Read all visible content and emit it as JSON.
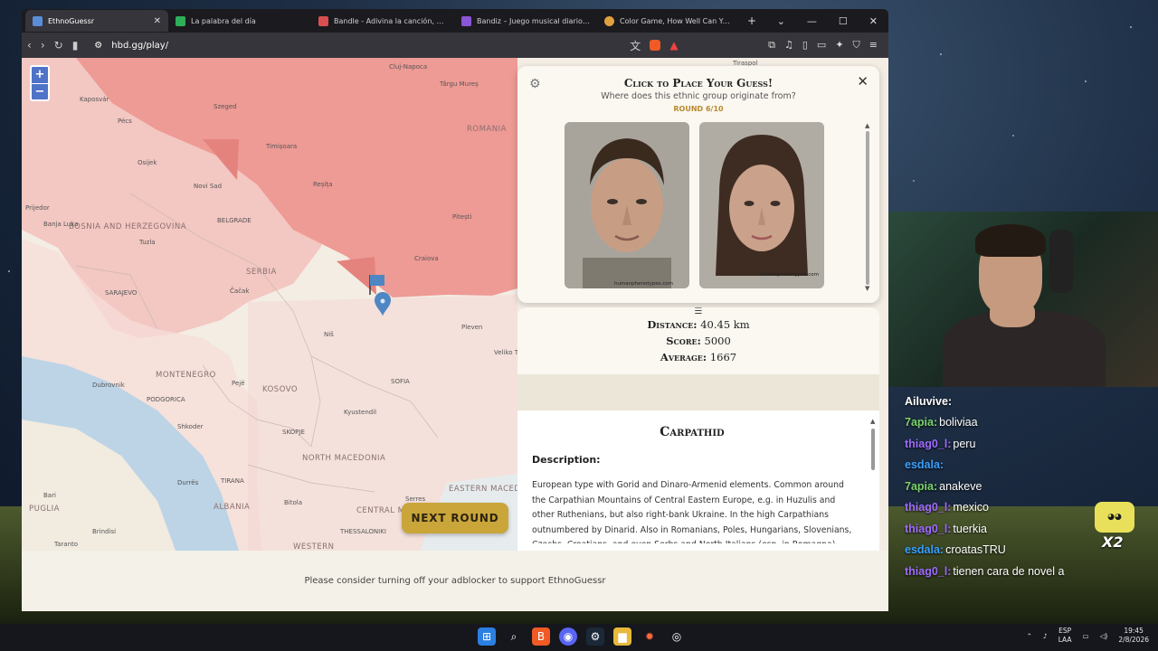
{
  "browser": {
    "tabs": [
      {
        "label": "EthnoGuessr",
        "active": true,
        "color": "#5a8dd6"
      },
      {
        "label": "La palabra del día",
        "active": false,
        "color": "#2fae5a"
      },
      {
        "label": "Bandle - Adivina la canción, un instr",
        "active": false,
        "color": "#d94f4f"
      },
      {
        "label": "Bandiz – Juego musical diario, pista",
        "active": false,
        "color": "#8a55d8"
      },
      {
        "label": "Color Game, How Well Can You Rem",
        "active": false,
        "color": "#e0a040"
      }
    ],
    "new_tab": "+",
    "url": "hbd.gg/play/"
  },
  "map": {
    "zoom_in": "+",
    "zoom_out": "−",
    "countries": {
      "romania": "ROMANIA",
      "bosnia": "BOSNIA AND HERZEGOVINA",
      "serbia": "SERBIA",
      "montenegro": "MONTENEGRO",
      "kosovo": "KOSOVO",
      "north_macedonia": "NORTH MACEDONIA",
      "albania": "ALBANIA",
      "eastern_macedonia": "EASTERN MACEDONIA",
      "central_macedonia": "CENTRAL MACEDONIA",
      "western": "WESTERN"
    },
    "cities": {
      "cluj": "Cluj-Napoca",
      "targu": "Târgu Mureș",
      "tiraspol": "Tiraspol",
      "kaposvar": "Kaposvár",
      "szeged": "Szeged",
      "pecs": "Pécs",
      "timisoara": "Timișoara",
      "osijek": "Osijek",
      "novisad": "Novi Sad",
      "resita": "Reșița",
      "prijedor": "Prijedor",
      "banjaluka": "Banja Luka",
      "belgrade": "BELGRADE",
      "pitesti": "Pitești",
      "tuzla": "Tuzla",
      "craiova": "Craiova",
      "sarajevo": "SARAJEVO",
      "cacak": "Čačak",
      "nis": "Niš",
      "pleven": "Pleven",
      "velikot": "Veliko T",
      "dubrovnik": "Dubrovnik",
      "peja": "Pejë",
      "sofia": "SOFIA",
      "podgorica": "PODGORICA",
      "kyustendil": "Kyustendil",
      "shkoder": "Shkoder",
      "skopje": "SKOPJE",
      "durres": "Durrës",
      "tirana": "TIRANA",
      "bitola": "Bitola",
      "serres": "Serres",
      "bari": "Bari",
      "puglia": "PUGLIA",
      "brindisi": "Brindisi",
      "thessaloniki": "THESSALONIKI",
      "taranto": "Taranto"
    },
    "next_round": "NEXT ROUND"
  },
  "guess_panel": {
    "title": "Click to Place Your Guess!",
    "subtitle": "Where does this ethnic group originate from?",
    "round": "ROUND 6/10",
    "male_caption": "humanphenotypes.com",
    "female_caption": "humanphenotypes.com",
    "close": "✕",
    "settings": "⚙"
  },
  "result_panel": {
    "handle": "☰",
    "distance_label": "Distance:",
    "distance_value": "40.45 km",
    "score_label": "Score:",
    "score_value": "5000",
    "average_label": "Average:",
    "average_value": "1667",
    "group_name": "Carpathid",
    "description_heading": "Description:",
    "description_text": "European type with Gorid and Dinaro-Armenid elements. Common around the Carpathian Mountains of Central Eastern Europe, e.g. in Huzulis and other Ruthenians, but also right-bank Ukraine. In the high Carpathians outnumbered by Dinarid. Also in Romanians, Poles, Hungarians, Slovenians, Czechs, Croatians, and even Serbs and North Italians (esp. in Romagna)."
  },
  "footer": {
    "adblock_notice": "Please consider turning off your adblocker to support EthnoGuessr"
  },
  "chat": [
    {
      "user": "Ailuvive:",
      "msg": "",
      "color": "#ffffff"
    },
    {
      "user": "7apia:",
      "msg": "boliviaa",
      "color": "#7cd36b"
    },
    {
      "user": "thiag0_l:",
      "msg": "peru",
      "color": "#a06bff"
    },
    {
      "user": "esdala:",
      "msg": "",
      "color": "#3aa0ff"
    },
    {
      "user": "7apia:",
      "msg": "anakeve",
      "color": "#7cd36b"
    },
    {
      "user": "thiag0_l:",
      "msg": "mexico",
      "color": "#a06bff"
    },
    {
      "user": "thiag0_l:",
      "msg": "tuerkia",
      "color": "#a06bff"
    },
    {
      "user": "esdala:",
      "msg": "croatasTRU",
      "color": "#3aa0ff"
    },
    {
      "user": "thiag0_l:",
      "msg": "tienen cara de novel a",
      "color": "#a06bff"
    }
  ],
  "stream": {
    "emote_multiplier": "X2"
  },
  "taskbar": {
    "lang_top": "ESP",
    "lang_bottom": "LAA",
    "time": "19:45",
    "date": "2/8/2026"
  }
}
